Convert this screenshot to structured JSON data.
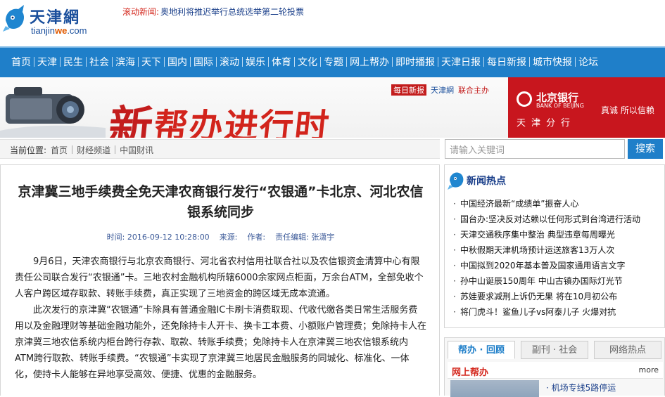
{
  "header": {
    "logo_cn": "天津網",
    "logo_en_a": "tianjin",
    "logo_en_b": "we",
    "logo_en_c": ".com",
    "ticker_label": "滚动新闻:",
    "ticker_text": "奥地利将推迟举行总统选举第二轮投票"
  },
  "nav": {
    "items": [
      "首页",
      "天津",
      "民生",
      "社会",
      "滨海",
      "天下",
      "国内",
      "国际",
      "滚动",
      "娱乐",
      "体育",
      "文化",
      "专题",
      "网上帮办",
      "即时播报",
      "天津日报",
      "每日新报",
      "城市快报",
      "论坛"
    ]
  },
  "banner": {
    "title_big": "新",
    "title_rest": "帮办进行时",
    "sponsor_paper": "每日新报",
    "sponsor_site": "天津網",
    "sponsor_text": "联合主办",
    "bank_name": "北京银行",
    "bank_en": "BANK OF BEIJING",
    "bank_slogan": "真诚  所以信赖",
    "bank_branch": "天津分行"
  },
  "breadcrumb": {
    "prefix": "当前位置:",
    "items": [
      "首页",
      "财经频道",
      "中国财讯"
    ]
  },
  "search": {
    "placeholder": "请输入关键词",
    "button": "搜索"
  },
  "article": {
    "title": "京津冀三地手续费全免天津农商银行发行“农银通”卡北京、河北农信银系统同步",
    "time": "时间: 2016-09-12 10:28:00",
    "source": "来源:",
    "author": "作者:",
    "editor": "责任编辑: 张潇宇",
    "paragraphs": [
      "9月6日，天津农商银行与北京农商银行、河北省农村信用社联合社以及农信银资金清算中心有限责任公司联合发行“农银通”卡。三地农村金融机构所辖6000余家网点柜面，万余台ATM，全部免收个人客户跨区域存取款、转账手续费，真正实现了三地资金的跨区域无成本流通。",
      "此次发行的京津冀“农银通”卡除具有普通金融IC卡刷卡消费取现、代收代缴各类日常生活服务费用以及金融理财等基础金融功能外，还免除持卡人开卡、换卡工本费、小额账户管理费；免除持卡人在京津冀三地农信系统内柜台跨行存款、取款、转账手续费；免除持卡人在京津冀三地农信银系统内ATM跨行取款、转账手续费。“农银通”卡实现了京津冀三地居民金融服务的同城化、标准化、一体化，使持卡人能够在异地享受高效、便捷、优惠的金融服务。"
    ]
  },
  "hot_news": {
    "title": "新闻热点",
    "items": [
      "中国经济最新“成绩单”振奋人心",
      "国台办:坚决反对达赖以任何形式到台湾进行活动",
      "天津交通秩序集中整治  典型违章每周曝光",
      "中秋假期天津机场预计运送旅客13万人次",
      "中国拟到2020年基本普及国家通用语言文字",
      "孙中山诞辰150周年  中山古镇办国际灯光节",
      "苏娃要求减刑上诉仍无果  将在10月初公布",
      "将门虎斗！鲨鱼儿子vs阿泰儿子  火爆对抗"
    ]
  },
  "tabs": {
    "items": [
      "帮办 · 回顾",
      "副刊 · 社会",
      "网络热点"
    ],
    "sub_title": "网上帮办",
    "more": "more",
    "item": "· 机场专线5路停运"
  }
}
